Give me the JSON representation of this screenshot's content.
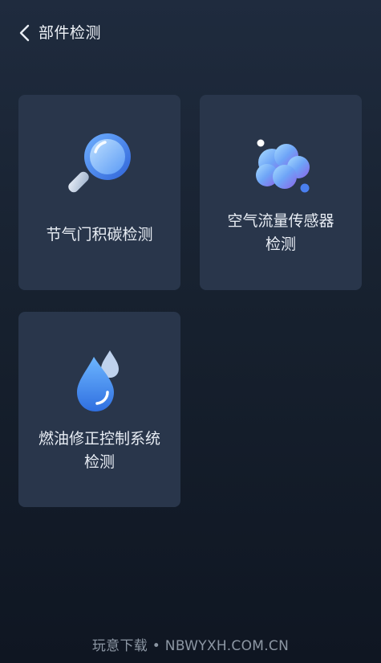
{
  "header": {
    "back_icon": "chevron-left-icon",
    "title": "部件检测"
  },
  "cards": [
    {
      "label": "节气门积碳检测",
      "icon": "magnifier-icon"
    },
    {
      "label": "空气流量传感器\n检测",
      "icon": "cloud-icon"
    },
    {
      "label": "燃油修正控制系统\n检测",
      "icon": "fuel-drop-icon"
    }
  ],
  "watermark": "玩意下载 • NBWYXH.COM.CN",
  "colors": {
    "background_top": "#1f2b3e",
    "background_bottom": "#0f1622",
    "card": "#29364b",
    "icon_blue": "#4a86f2",
    "text": "#e8edf4"
  }
}
